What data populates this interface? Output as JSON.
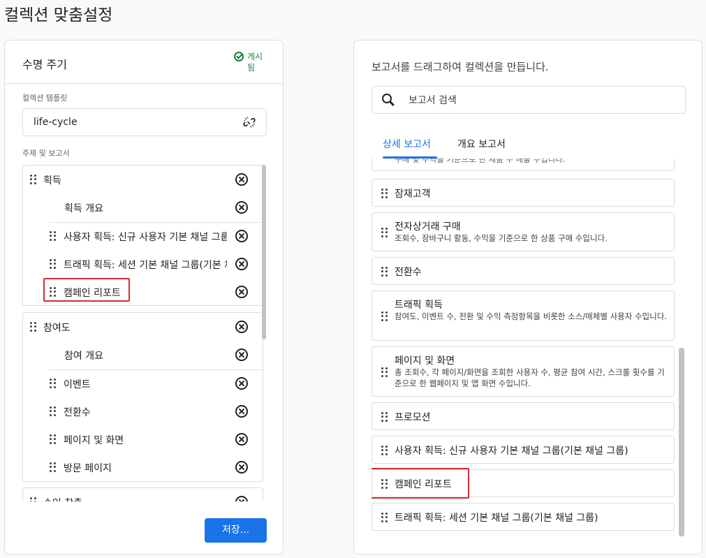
{
  "page": {
    "title": "컬렉션 맞춤설정"
  },
  "left_panel": {
    "title": "수명 주기",
    "status": "게시됨",
    "template_label": "컬렉션 템플릿",
    "template_value": "life-cycle",
    "topics_label": "주제 및 보고서",
    "groups": [
      {
        "name": "획득",
        "items": [
          "획득 개요",
          "사용자 획득: 신규 사용자 기본 채널 그룹(기본 채널 그룹)",
          "트래픽 획득: 세션 기본 채널 그룹(기본 채널 그룹)",
          "캠페인 리포트"
        ]
      },
      {
        "name": "참여도",
        "items": [
          "참여 개요",
          "이벤트",
          "전환수",
          "페이지 및 화면",
          "방문 페이지"
        ]
      },
      {
        "name": "수익 창출",
        "items": []
      }
    ],
    "save_label": "저장..."
  },
  "right_panel": {
    "intro": "보고서를 드래그하여 컬렉션을 만듭니다.",
    "search_placeholder": "보고서 검색",
    "tabs": [
      {
        "label": "상세 보고서",
        "active": true
      },
      {
        "label": "개요 보고서",
        "active": false
      }
    ],
    "partial_top_text": "구매 및 수익을 기준으로 한 제품 수 매출 수입니다.",
    "reports": [
      {
        "title": "잠재고객",
        "desc": ""
      },
      {
        "title": "전자상거래 구매",
        "desc": "조회수, 장바구니 활동, 수익을 기준으로 한 상품 구매 수입니다."
      },
      {
        "title": "전환수",
        "desc": ""
      },
      {
        "title": "트래픽 획득",
        "desc": "참여도, 이벤트 수, 전환 및 수익 측정항목을 비롯한 소스/매체별 사용자 수입니다."
      },
      {
        "title": "페이지 및 화면",
        "desc": "총 조회수, 각 페이지/화면을 조회한 사용자 수, 평균 참여 시간, 스크롤 횟수를 기준으로 한 웹페이지 및 앱 화면 수입니다."
      },
      {
        "title": "프로모션",
        "desc": ""
      },
      {
        "title": "사용자 획득: 신규 사용자 기본 채널 그룹(기본 채널 그룹)",
        "desc": ""
      },
      {
        "title": "캠페인 리포트",
        "desc": ""
      },
      {
        "title": "트래픽 획득: 세션 기본 채널 그룹(기본 채널 그룹)",
        "desc": ""
      }
    ]
  },
  "colors": {
    "accent": "#1a73e8",
    "published": "#188038",
    "highlight": "#d32f2f"
  }
}
